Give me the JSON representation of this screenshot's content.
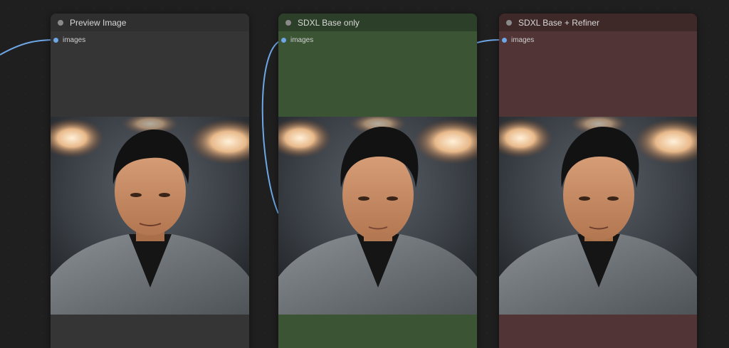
{
  "nodes": {
    "preview": {
      "title": "Preview Image",
      "input_label": "images",
      "image_alt": "Portrait: man with slicked-back hair in grey suit jacket and black shirt, warm bokeh lamps background"
    },
    "base": {
      "title": "SDXL Base only",
      "input_label": "images",
      "image_alt": "Portrait: younger man, smooth skin, slicked-back hair, grey suit jacket and black shirt, warm bokeh lamps background"
    },
    "refiner": {
      "title": "SDXL Base + Refiner",
      "input_label": "images",
      "image_alt": "Portrait: younger man, slicked-back hair, grey suit jacket and black shirt, warm bokeh lamps background"
    }
  },
  "colors": {
    "canvas": "#1f1f20",
    "link": "#6ea6e6",
    "preview_body": "#353535",
    "base_body": "#3a5434",
    "refiner_body": "#513435"
  },
  "icons": {
    "collapse": "collapse-dot-icon",
    "slot": "input-slot-dot-icon"
  }
}
